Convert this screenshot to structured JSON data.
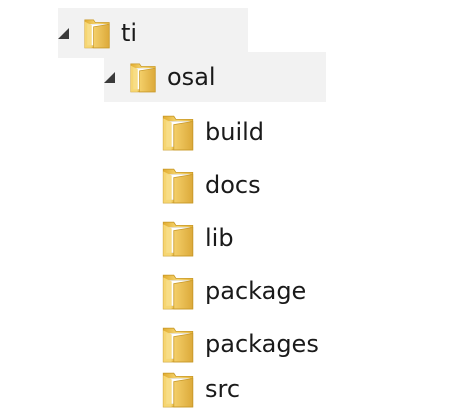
{
  "tree": {
    "root": {
      "label": "ti",
      "icon": "folder-icon",
      "expanded": true,
      "children": {
        "osal": {
          "label": "osal",
          "icon": "folder-icon",
          "expanded": true,
          "children": [
            {
              "label": "build",
              "icon": "folder-icon"
            },
            {
              "label": "docs",
              "icon": "folder-icon"
            },
            {
              "label": "lib",
              "icon": "folder-icon"
            },
            {
              "label": "package",
              "icon": "folder-icon"
            },
            {
              "label": "packages",
              "icon": "folder-icon"
            },
            {
              "label": "src",
              "icon": "folder-icon"
            }
          ]
        }
      }
    }
  },
  "colors": {
    "folder_body": "#f2cf63",
    "folder_front": "#e7b83f",
    "folder_edge": "#c99a2a",
    "folder_paper": "#ffffff",
    "expander": "#3a3a3a",
    "row_highlight": "#f2f2f2"
  }
}
